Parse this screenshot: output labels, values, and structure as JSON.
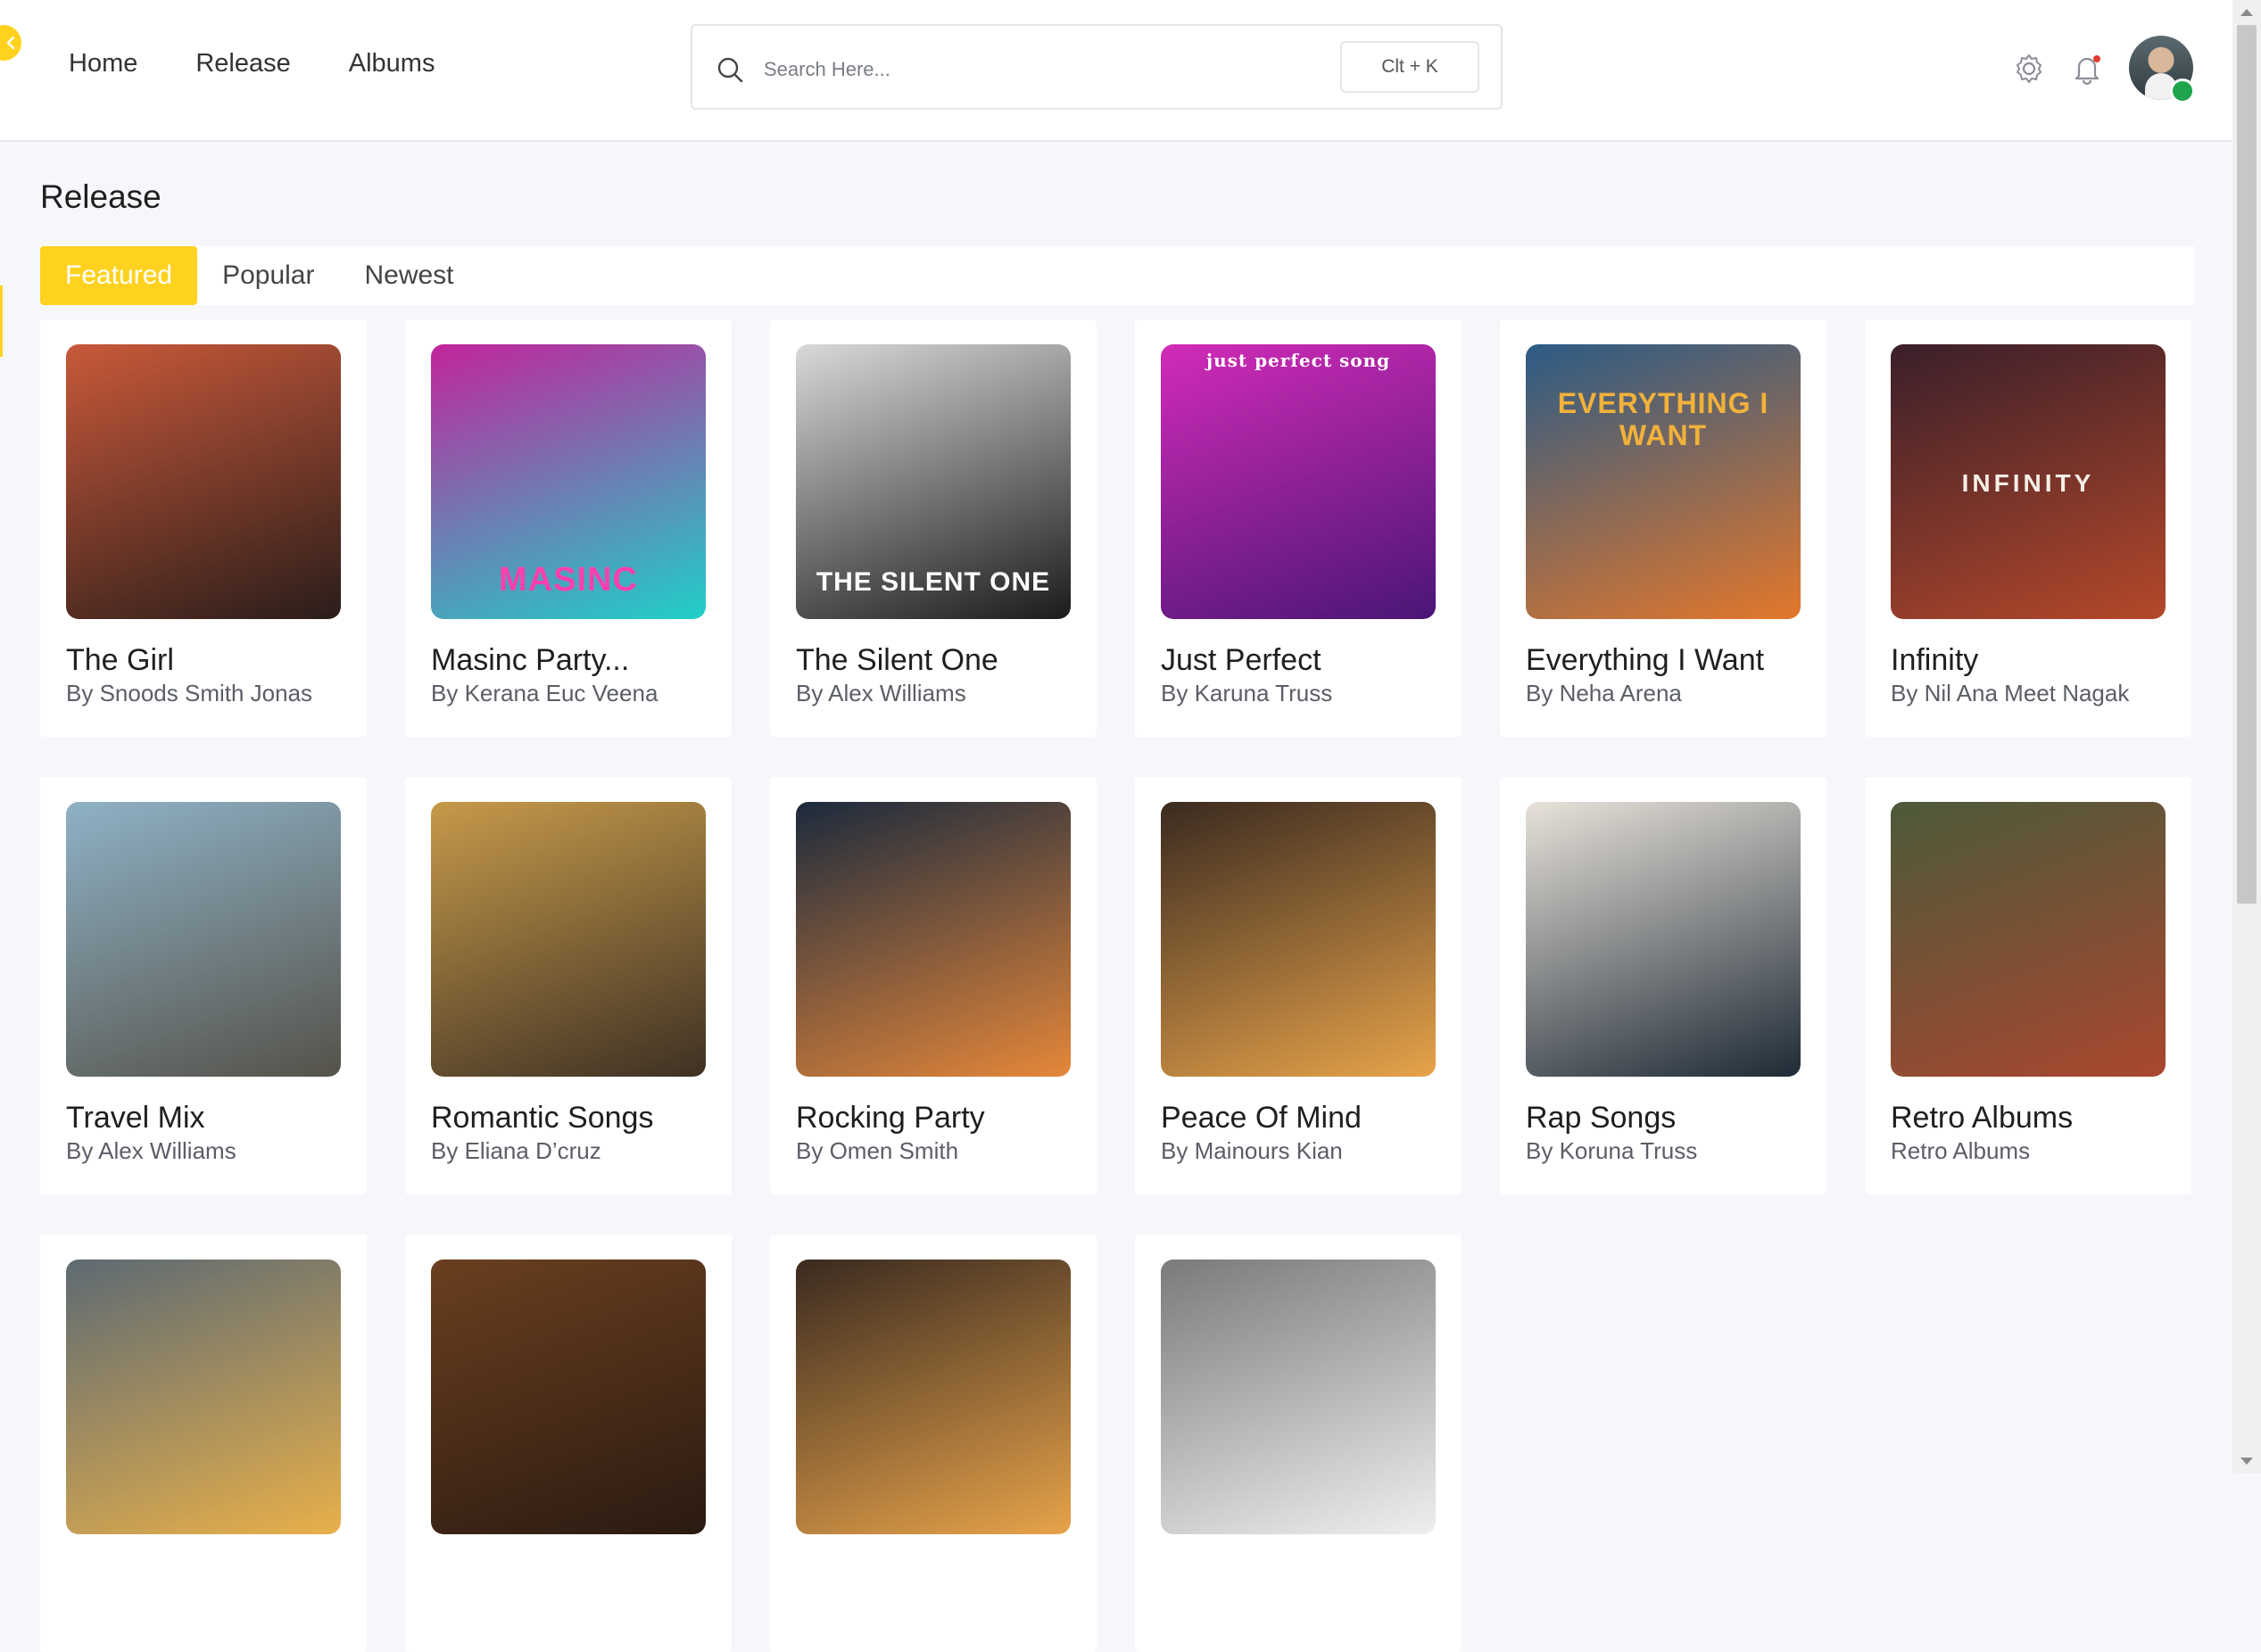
{
  "nav": {
    "home": "Home",
    "release": "Release",
    "albums": "Albums"
  },
  "search": {
    "placeholder": "Search Here...",
    "shortcut": "Clt + K"
  },
  "page": {
    "title": "Release"
  },
  "tabs": [
    {
      "label": "Featured",
      "active": true
    },
    {
      "label": "Popular",
      "active": false
    },
    {
      "label": "Newest",
      "active": false
    }
  ],
  "accent_color": "#ffd21f",
  "cards": [
    {
      "title": "The Girl",
      "artist": "By Snoods Smith Jonas",
      "cover_text": "",
      "colors": [
        "#c9593a",
        "#2a1d1a"
      ]
    },
    {
      "title": "Masinc Party...",
      "artist": "By Kerana Euc Veena",
      "cover_text": "MASINC",
      "colors": [
        "#c2249b",
        "#1fd0c8"
      ]
    },
    {
      "title": "The Silent One",
      "artist": "By Alex Williams",
      "cover_text": "THE SILENT ONE",
      "colors": [
        "#d9d9d9",
        "#1b1b1b"
      ]
    },
    {
      "title": "Just Perfect",
      "artist": "By Karuna Truss",
      "cover_text": "just perfect song",
      "colors": [
        "#d22bb8",
        "#4a1676"
      ]
    },
    {
      "title": "Everything I Want",
      "artist": "By Neha Arena",
      "cover_text": "EVERYTHING I WANT",
      "colors": [
        "#2b5b86",
        "#e3772b"
      ]
    },
    {
      "title": "Infinity",
      "artist": "By Nil Ana Meet Nagak",
      "cover_text": "INFINITY",
      "colors": [
        "#3a1f2a",
        "#b4482a"
      ]
    },
    {
      "title": "Travel Mix",
      "artist": "By Alex Williams",
      "cover_text": "",
      "colors": [
        "#8fb2c6",
        "#55524a"
      ]
    },
    {
      "title": "Romantic Songs",
      "artist": "By Eliana D’cruz",
      "cover_text": "",
      "colors": [
        "#c79a4a",
        "#3e3124"
      ]
    },
    {
      "title": "Rocking Party",
      "artist": "By Omen Smith",
      "cover_text": "",
      "colors": [
        "#1c2a3d",
        "#e5873a"
      ]
    },
    {
      "title": "Peace Of Mind",
      "artist": "By Mainours Kian",
      "cover_text": "",
      "colors": [
        "#3a2a20",
        "#e7a34a"
      ]
    },
    {
      "title": "Rap Songs",
      "artist": "By Koruna Truss",
      "cover_text": "",
      "colors": [
        "#e8e2da",
        "#1e2a36"
      ]
    },
    {
      "title": "Retro Albums",
      "artist": "Retro Albums",
      "cover_text": "",
      "colors": [
        "#4c5a3a",
        "#a9472f"
      ]
    },
    {
      "title": "",
      "artist": "",
      "cover_text": "",
      "colors": [
        "#5d6a73",
        "#e8b04a"
      ]
    },
    {
      "title": "",
      "artist": "",
      "cover_text": "",
      "colors": [
        "#6b3f1f",
        "#2a1a12"
      ]
    },
    {
      "title": "",
      "artist": "",
      "cover_text": "",
      "colors": [
        "#3a2a20",
        "#e7a34a"
      ]
    },
    {
      "title": "",
      "artist": "",
      "cover_text": "",
      "colors": [
        "#7a7a7a",
        "#efefef"
      ]
    }
  ]
}
